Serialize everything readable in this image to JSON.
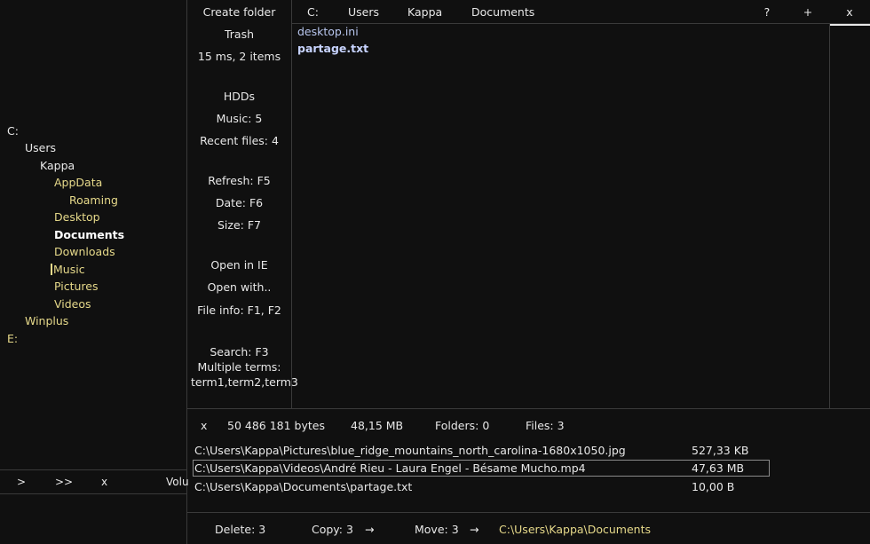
{
  "tree": {
    "items": [
      {
        "label": "C:",
        "depth": 0,
        "style": "white"
      },
      {
        "label": "Users",
        "depth": 1,
        "style": "white"
      },
      {
        "label": "Kappa",
        "depth": 2,
        "style": "white"
      },
      {
        "label": "AppData",
        "depth": 3,
        "style": "yellow"
      },
      {
        "label": "Roaming",
        "depth": 4,
        "style": "yellow"
      },
      {
        "label": "Desktop",
        "depth": 3,
        "style": "yellow"
      },
      {
        "label": "Documents",
        "depth": 3,
        "style": "bold"
      },
      {
        "label": "Downloads",
        "depth": 3,
        "style": "yellow"
      },
      {
        "label": "Music",
        "depth": 3,
        "style": "yellow"
      },
      {
        "label": "Pictures",
        "depth": 3,
        "style": "yellow"
      },
      {
        "label": "Videos",
        "depth": 3,
        "style": "yellow"
      },
      {
        "label": "Winplus",
        "depth": 1,
        "style": "yellow"
      },
      {
        "label": "E:",
        "depth": 0,
        "style": "yellow"
      }
    ]
  },
  "leftbar": {
    "forward": ">",
    "fast_forward": ">>",
    "close": "x",
    "volume": "Volu"
  },
  "actions": {
    "create_folder": "Create folder",
    "trash": "Trash",
    "timing": "15 ms,  2 items",
    "hdds": "HDDs",
    "music": "Music: 5",
    "recent_files": "Recent files: 4",
    "refresh": "Refresh: F5",
    "date": "Date: F6",
    "size": "Size: F7",
    "open_ie": "Open in IE",
    "open_with": "Open with..",
    "file_info": "File info: F1, F2",
    "search": "Search: F3 Multiple terms: term1,term2,term3"
  },
  "breadcrumb": {
    "items": [
      "C:",
      "Users",
      "Kappa",
      "Documents"
    ]
  },
  "topbar": {
    "help": "?",
    "add": "+",
    "close": "x"
  },
  "files": [
    {
      "name": "desktop.ini",
      "bold": false
    },
    {
      "name": "partage.txt",
      "bold": true
    }
  ],
  "stats": {
    "close": "x",
    "bytes": "50 486 181 bytes",
    "mb": "48,15 MB",
    "folders": "Folders:  0",
    "files": "Files:  3"
  },
  "recent": [
    {
      "path": "C:\\Users\\Kappa\\Pictures\\blue_ridge_mountains_north_carolina-1680x1050.jpg",
      "size": "527,33 KB",
      "selected": false
    },
    {
      "path": "C:\\Users\\Kappa\\Videos\\André Rieu - Laura Engel - Bésame Mucho.mp4",
      "size": "47,63 MB",
      "selected": true
    },
    {
      "path": "C:\\Users\\Kappa\\Documents\\partage.txt",
      "size": "10,00 B",
      "selected": false
    }
  ],
  "status": {
    "delete": "Delete:  3",
    "copy": "Copy:  3",
    "copy_arrow": "→",
    "move": "Move:  3",
    "move_arrow": "→",
    "path": "C:\\Users\\Kappa\\Documents"
  },
  "colors": {
    "background": "#101010",
    "folder_yellow": "#e6d98a",
    "file_blue": "#b8c6ee"
  }
}
